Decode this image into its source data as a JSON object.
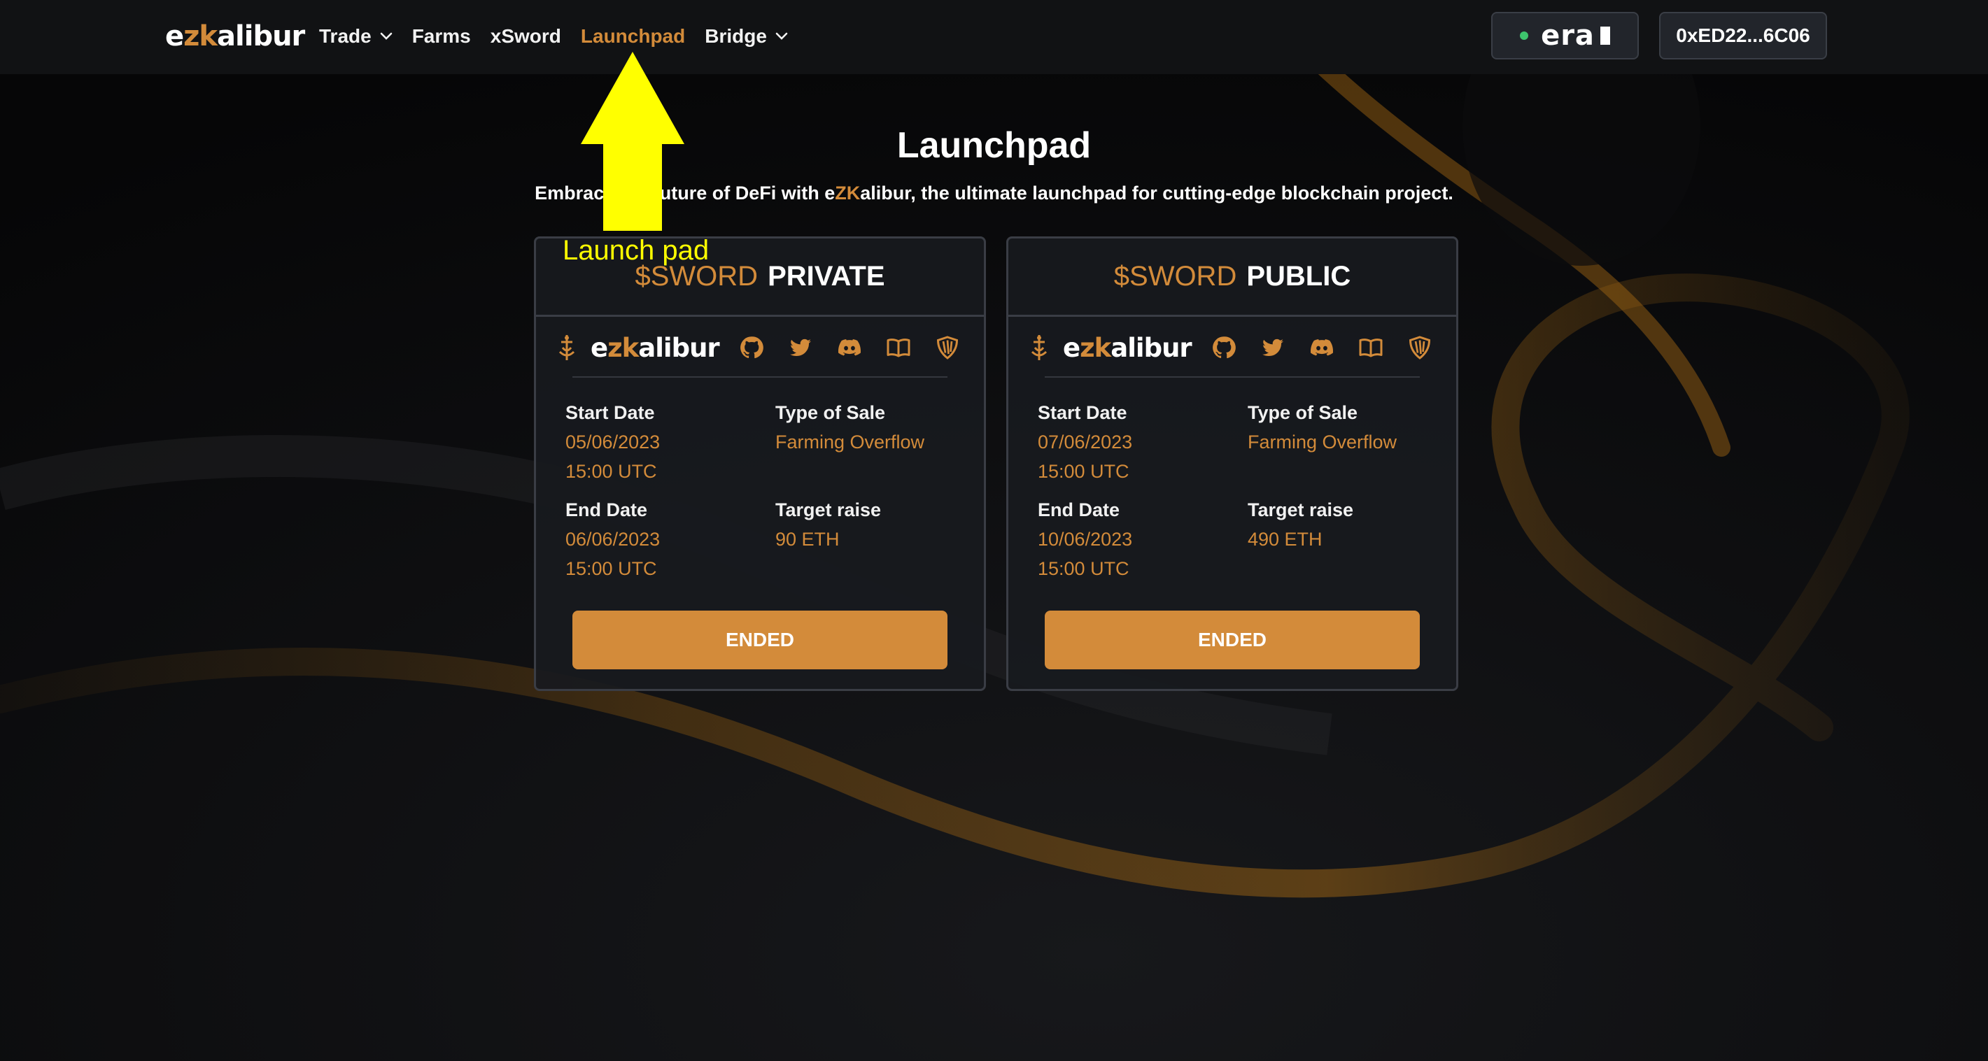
{
  "colors": {
    "accent": "#d38b3a",
    "background": "#050506",
    "navbar": "#111214",
    "card": "#181a1e",
    "annotation": "#ffff00",
    "network_dot": "#3ec46d"
  },
  "nav": {
    "logo": {
      "prefix": "e",
      "highlight": "zk",
      "suffix": "alibur"
    },
    "items": [
      {
        "label": "Trade",
        "dropdown": true
      },
      {
        "label": "Farms",
        "dropdown": false
      },
      {
        "label": "xSword",
        "dropdown": false
      },
      {
        "label": "Launchpad",
        "dropdown": false,
        "active": true
      },
      {
        "label": "Bridge",
        "dropdown": true
      }
    ],
    "network": {
      "label": "era",
      "status_icon": "green-dot"
    },
    "wallet": "0xED22...6C06"
  },
  "header": {
    "title": "Launchpad",
    "subtitle_before": "Embrace the future of DeFi with e",
    "subtitle_highlight": "ZK",
    "subtitle_after": "alibur, the ultimate launchpad for cutting-edge blockchain project."
  },
  "cards": [
    {
      "token": "$SWORD",
      "kind": "PRIVATE",
      "labels": {
        "start": "Start Date",
        "type": "Type of Sale",
        "end": "End Date",
        "target": "Target raise"
      },
      "start_date": "05/06/2023",
      "start_time": "15:00 UTC",
      "type_of_sale": "Farming Overflow",
      "end_date": "06/06/2023",
      "end_time": "15:00 UTC",
      "target_raise": "90 ETH",
      "button": "ENDED"
    },
    {
      "token": "$SWORD",
      "kind": "PUBLIC",
      "labels": {
        "start": "Start Date",
        "type": "Type of Sale",
        "end": "End Date",
        "target": "Target raise"
      },
      "start_date": "07/06/2023",
      "start_time": "15:00 UTC",
      "type_of_sale": "Farming Overflow",
      "end_date": "10/06/2023",
      "end_time": "15:00 UTC",
      "target_raise": "490 ETH",
      "button": "ENDED"
    }
  ],
  "card_logo": {
    "prefix": "e",
    "highlight": "zk",
    "suffix": "alibur"
  },
  "social_icons": [
    "github-icon",
    "twitter-icon",
    "discord-icon",
    "docs-book-icon",
    "shield-icon"
  ],
  "annotation": {
    "label": "Launch pad",
    "arrow": "up-arrow"
  }
}
